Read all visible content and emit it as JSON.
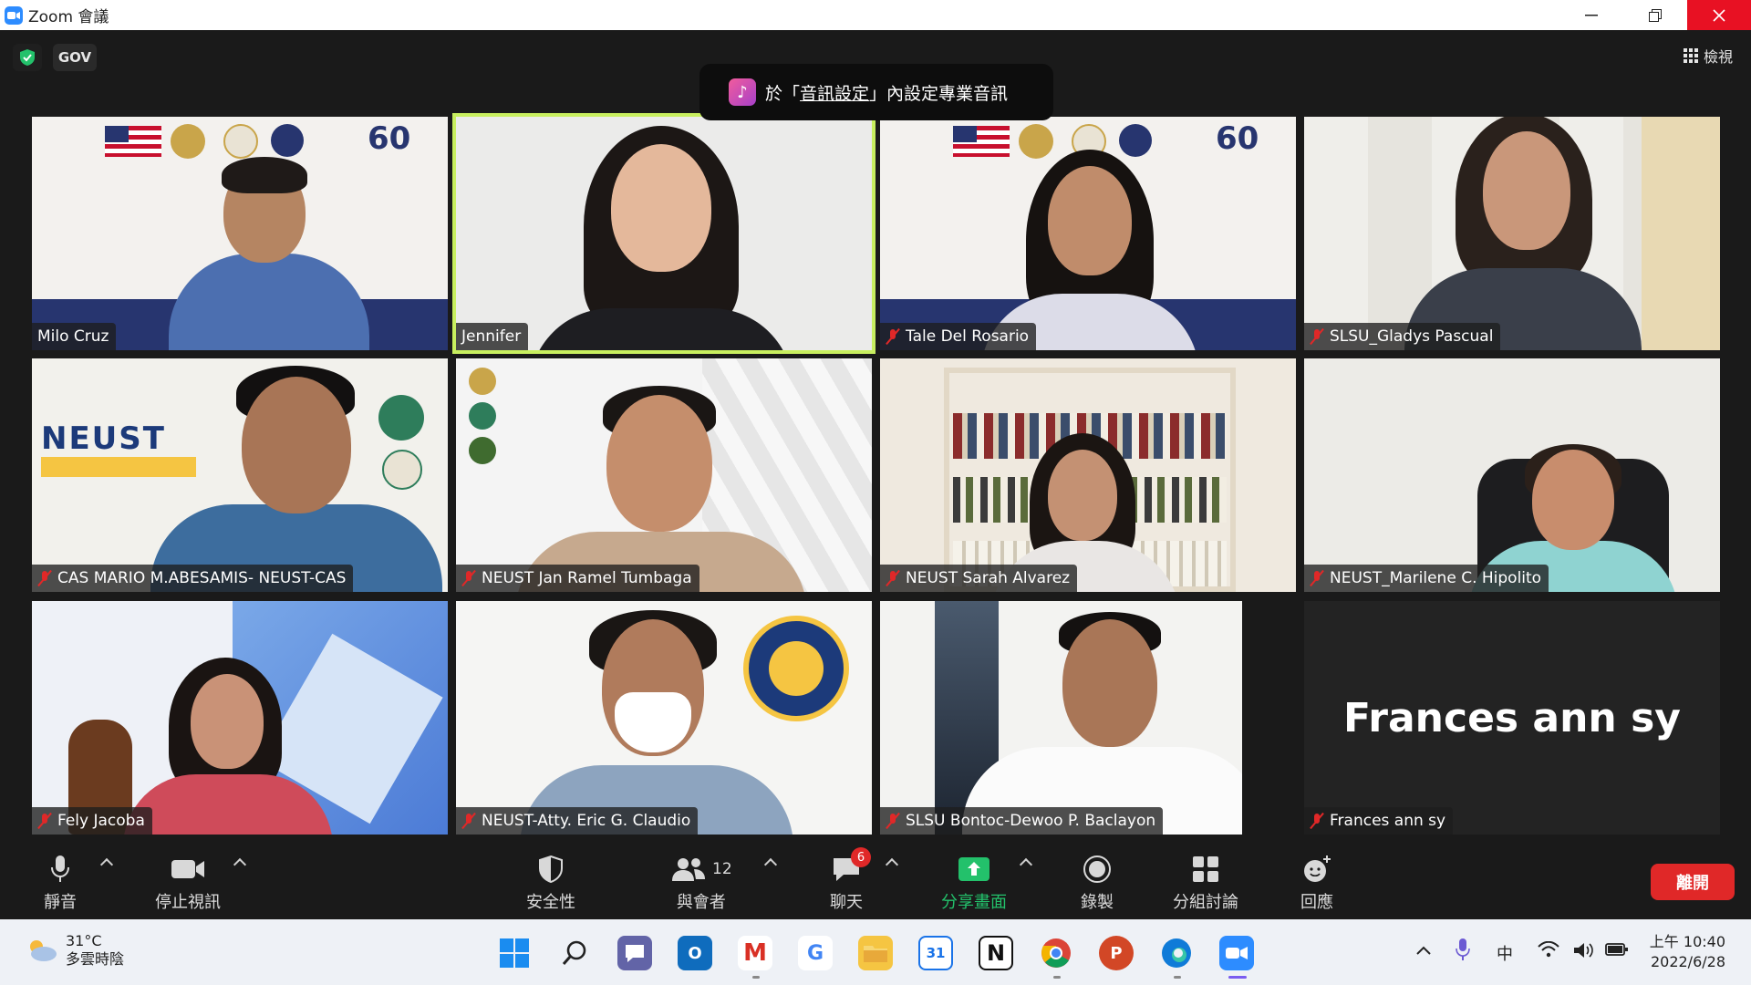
{
  "window": {
    "title": "Zoom 會議"
  },
  "meeting": {
    "gov_label": "GOV",
    "view_label": "檢視"
  },
  "notice": {
    "prefix": "於「",
    "link": "音訊設定",
    "suffix": "」內設定專業音訊"
  },
  "participants": [
    {
      "name": "Milo Cruz",
      "muted": false
    },
    {
      "name": "Jennifer",
      "muted": false,
      "active": true
    },
    {
      "name": "Tale Del Rosario",
      "muted": true
    },
    {
      "name": "SLSU_Gladys Pascual",
      "muted": true
    },
    {
      "name": "CAS MARIO M.ABESAMIS- NEUST-CAS",
      "muted": true
    },
    {
      "name": "NEUST Jan Ramel Tumbaga",
      "muted": true
    },
    {
      "name": "NEUST Sarah Alvarez",
      "muted": true
    },
    {
      "name": "NEUST_Marilene C. Hipolito",
      "muted": true
    },
    {
      "name": "Fely Jacoba",
      "muted": true
    },
    {
      "name": "NEUST-Atty. Eric G. Claudio",
      "muted": true
    },
    {
      "name": "SLSU Bontoc-Dewoo P. Baclayon",
      "muted": true
    },
    {
      "name": "Frances ann sy",
      "muted": true,
      "video_off": true
    }
  ],
  "frances_display": "Frances ann sy",
  "toolbar": {
    "mute": "靜音",
    "stop_video": "停止視訊",
    "security": "安全性",
    "participants": "與會者",
    "participants_count": "12",
    "chat": "聊天",
    "chat_badge": "6",
    "share": "分享畫面",
    "record": "錄製",
    "breakout": "分組討論",
    "reactions": "回應",
    "leave": "離開"
  },
  "taskbar": {
    "weather_temp": "31°C",
    "weather_desc": "多雲時陰",
    "ime": "中",
    "time": "上午 10:40",
    "date": "2022/6/28"
  }
}
